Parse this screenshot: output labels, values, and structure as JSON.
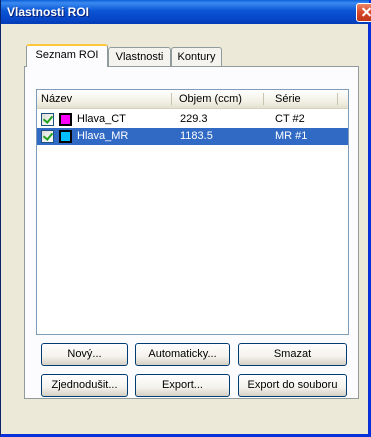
{
  "window": {
    "title": "Vlastnosti ROI"
  },
  "tabs": [
    {
      "label": "Seznam ROI",
      "active": true
    },
    {
      "label": "Vlastnosti",
      "active": false
    },
    {
      "label": "Kontury",
      "active": false
    }
  ],
  "list": {
    "columns": [
      "Název",
      "Objem (ccm)",
      "Série"
    ],
    "rows": [
      {
        "name": "Hlava_CT",
        "volume": "229.3",
        "series": "CT #2",
        "checked": true,
        "color": "#ff00ff",
        "selected": false
      },
      {
        "name": "Hlava_MR",
        "volume": "1183.5",
        "series": "MR #1",
        "checked": true,
        "color": "#00bfff",
        "selected": true
      }
    ]
  },
  "buttons": {
    "new": "Nový...",
    "auto": "Automaticky...",
    "delete": "Smazat",
    "simplify": "Zjednodušit...",
    "export": "Export...",
    "export_file": "Export do souboru"
  },
  "colors": {
    "title_bar": "#0a55d5",
    "selection": "#316ac5",
    "active_tab_accent": "#ffc73c"
  }
}
